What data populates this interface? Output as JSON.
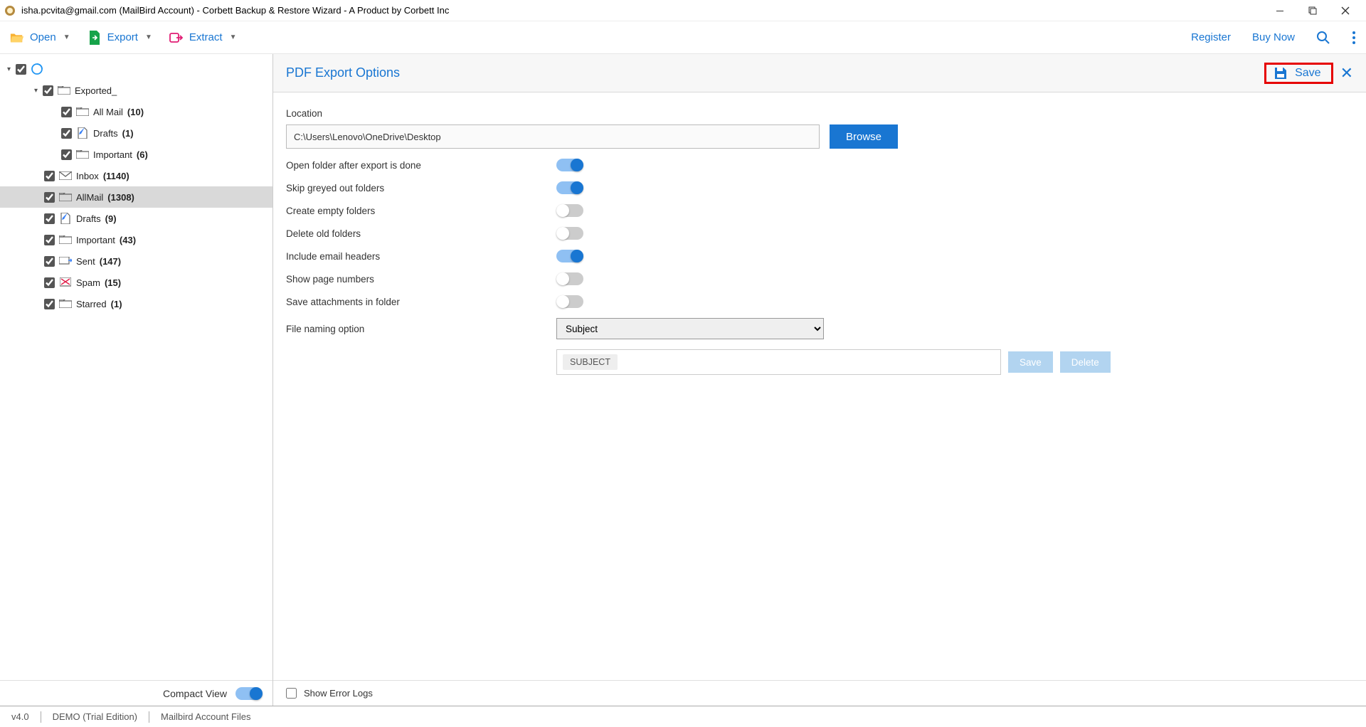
{
  "titlebar": {
    "title": "isha.pcvita@gmail.com (MailBird Account) - Corbett Backup & Restore Wizard - A Product by Corbett Inc"
  },
  "toolbar": {
    "open_label": "Open",
    "export_label": "Export",
    "extract_label": "Extract",
    "register_label": "Register",
    "buynow_label": "Buy Now"
  },
  "sidebar": {
    "root_label": "",
    "folders": [
      {
        "label": "Exported_",
        "count": "",
        "indent": 1,
        "expandable": true,
        "selected": false,
        "icon": "folder"
      },
      {
        "label": "All Mail",
        "count": "(10)",
        "indent": 2,
        "icon": "folder"
      },
      {
        "label": "Drafts",
        "count": "(1)",
        "indent": 2,
        "icon": "draft"
      },
      {
        "label": "Important",
        "count": "(6)",
        "indent": 2,
        "icon": "folder"
      },
      {
        "label": "Inbox",
        "count": "(1140)",
        "indent": 1,
        "icon": "inbox"
      },
      {
        "label": "AllMail",
        "count": "(1308)",
        "indent": 1,
        "selected": true,
        "icon": "folder"
      },
      {
        "label": "Drafts",
        "count": "(9)",
        "indent": 1,
        "icon": "draft"
      },
      {
        "label": "Important",
        "count": "(43)",
        "indent": 1,
        "icon": "folder"
      },
      {
        "label": "Sent",
        "count": "(147)",
        "indent": 1,
        "icon": "sent"
      },
      {
        "label": "Spam",
        "count": "(15)",
        "indent": 1,
        "icon": "spam"
      },
      {
        "label": "Starred",
        "count": "(1)",
        "indent": 1,
        "icon": "folder"
      }
    ],
    "compact_label": "Compact View"
  },
  "options": {
    "header_title": "PDF Export Options",
    "save_label": "Save",
    "location_label": "Location",
    "location_value": "C:\\Users\\Lenovo\\OneDrive\\Desktop",
    "browse_label": "Browse",
    "toggles": [
      {
        "label": "Open folder after export is done",
        "on": true
      },
      {
        "label": "Skip greyed out folders",
        "on": true
      },
      {
        "label": "Create empty folders",
        "on": false
      },
      {
        "label": "Delete old folders",
        "on": false
      },
      {
        "label": "Include email headers",
        "on": true
      },
      {
        "label": "Show page numbers",
        "on": false
      },
      {
        "label": "Save attachments in folder",
        "on": false
      }
    ],
    "file_naming_label": "File naming option",
    "file_naming_value": "Subject",
    "chip_value": "SUBJECT",
    "small_save_label": "Save",
    "small_delete_label": "Delete",
    "show_error_logs_label": "Show Error Logs"
  },
  "statusbar": {
    "version": "v4.0",
    "edition": "DEMO (Trial Edition)",
    "context": "Mailbird Account Files"
  }
}
